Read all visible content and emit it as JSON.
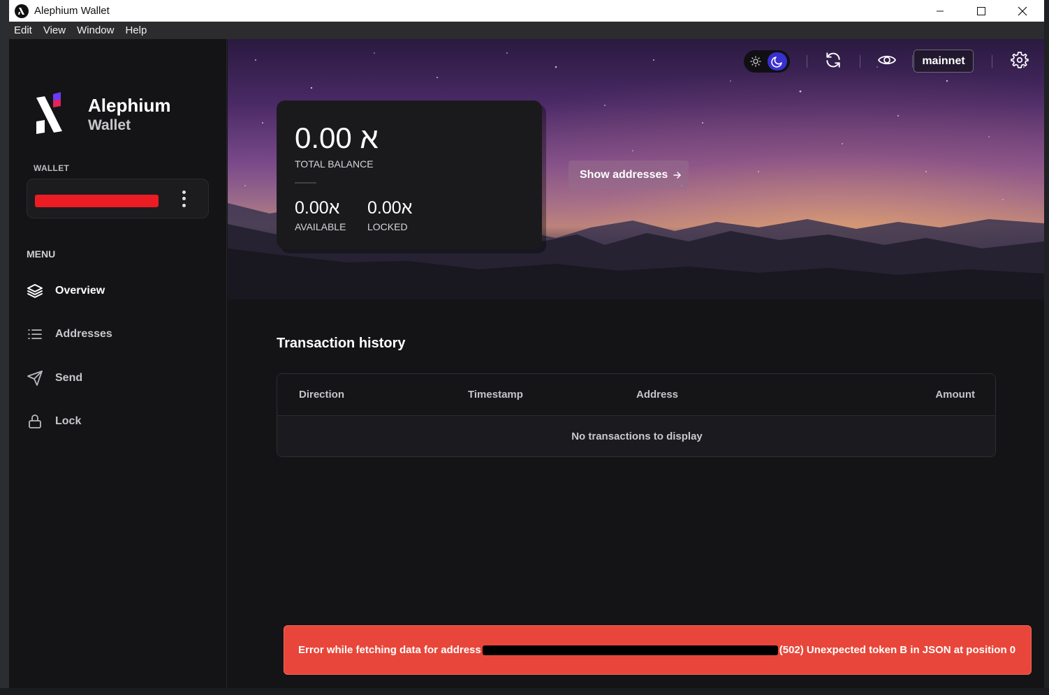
{
  "window": {
    "title": "Alephium Wallet"
  },
  "menubar": {
    "items": [
      "Edit",
      "View",
      "Window",
      "Help"
    ]
  },
  "sidebar": {
    "brand_name": "Alephium",
    "brand_sub": "Wallet",
    "wallet_label": "WALLET",
    "menu_label": "MENU",
    "nav": [
      {
        "label": "Overview",
        "icon": "layers-icon"
      },
      {
        "label": "Addresses",
        "icon": "list-icon"
      },
      {
        "label": "Send",
        "icon": "send-icon"
      },
      {
        "label": "Lock",
        "icon": "lock-icon"
      }
    ]
  },
  "header": {
    "network": "mainnet",
    "theme": "dark"
  },
  "balance": {
    "total": "0.00",
    "total_label": "TOTAL BALANCE",
    "available": "0.00",
    "available_label": "AVAILABLE",
    "locked": "0.00",
    "locked_label": "LOCKED",
    "currency_symbol": "א"
  },
  "show_addresses_label": "Show addresses",
  "transactions": {
    "title": "Transaction history",
    "columns": [
      "Direction",
      "Timestamp",
      "Address",
      "Amount"
    ],
    "empty_text": "No transactions to display"
  },
  "error": {
    "prefix": "Error while fetching data for address",
    "suffix": "(502) Unexpected token B in JSON at position 0"
  },
  "colors": {
    "accent": "#3a2fd0",
    "error": "#e8463a",
    "redaction": "#ec1c24"
  }
}
